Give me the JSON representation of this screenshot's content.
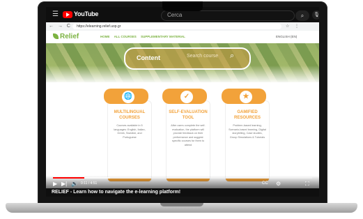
{
  "youtube": {
    "brand": "YouTube",
    "search_placeholder": "Cerca",
    "menu_icon": "☰",
    "search_icon": "⌕",
    "mic_icon": "🎙"
  },
  "browser": {
    "nav_icons": "← → C",
    "url": "https://elearning.relief.uop.gr",
    "toolbar_icons": "☆ ⋮"
  },
  "site": {
    "brand": "Relief",
    "nav": [
      "HOME",
      "ALL COURSES",
      "SUPPLEMENTARY MATERIAL"
    ],
    "language": "ENGLISH (EN)",
    "search_pill": {
      "label": "Content",
      "placeholder": "Search course"
    },
    "cards": [
      {
        "icon": "🌐",
        "title": "MULTILINGUAL COURSES",
        "text": "Courses available in 5 languages: English, Italian, Greek, Swedish, and Portuguese"
      },
      {
        "icon": "✓",
        "title": "SELF-EVALUATION TOOL",
        "text": "After users complete the self-evaluation, the platform will provide feedback on their performance and suggest specific courses for them to attend"
      },
      {
        "icon": "★",
        "title": "GAMIFIED RESOURCES",
        "text": "Problem-based learning, Scenario-based learning, Digital storytelling, Case studies, Group Simulations & Tutorials"
      }
    ]
  },
  "player": {
    "time": "0:11 / 4:51",
    "progress_percent": 12,
    "buffered_percent": 22,
    "controls": {
      "play": "▶",
      "next": "▶|",
      "volume": "🔊",
      "settings": "⚙",
      "subtitles": "CC",
      "fullscreen": "⛶"
    }
  },
  "video_title": "RELIEF - Learn how to navigate the e-learning platform!"
}
